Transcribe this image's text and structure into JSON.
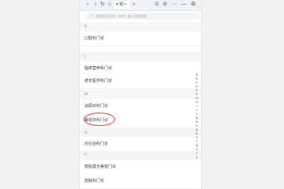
{
  "tab": {
    "label": "预",
    "icon": "green-v-icon"
  },
  "titlebar": {
    "back_icon": "chevron-left-icon",
    "forward_icon": "chevron-right-icon",
    "refresh_icon": "refresh-icon",
    "home_icon": "home-icon",
    "close_tab": "×",
    "window_buttons": [
      "⊙",
      "⊘",
      "⋯",
      "—",
      "⧉"
    ]
  },
  "search": {
    "placeholder": "搜索科室名称、疾病、输入拼音搜索"
  },
  "sections": [
    {
      "letter": "K",
      "items": [
        "口腔科门诊"
      ]
    },
    {
      "letter": "L",
      "items": [
        "临床营养科门诊",
        "老年医学科门诊"
      ]
    },
    {
      "letter": "M",
      "items": [
        "泌尿外科门诊",
        "美容外科门诊"
      ]
    },
    {
      "letter": "N",
      "items": [
        "内分泌科门诊"
      ]
    },
    {
      "letter": "P",
      "items": [
        "皮肤激光美容门诊",
        "皮肤科门诊"
      ]
    }
  ],
  "alpha_index": [
    "A",
    "B",
    "C",
    "D",
    "E",
    "F",
    "G",
    "H",
    "J",
    "K",
    "L",
    "M",
    "N",
    "P",
    "Q",
    "R",
    "S",
    "T",
    "W",
    "X",
    "Y",
    "Z"
  ],
  "alpha_active": "K",
  "colors": {
    "accent": "#2a8bd6",
    "annotation": "#e03a3a",
    "tab_icon": "#1aa260"
  }
}
